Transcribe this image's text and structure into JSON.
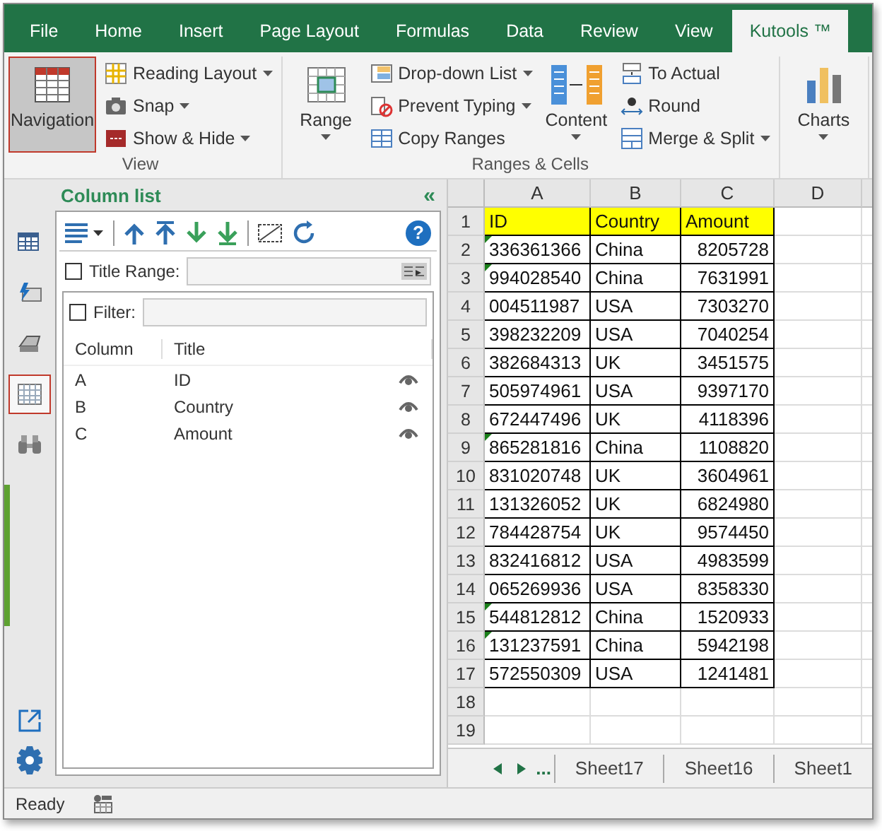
{
  "tabs": [
    {
      "label": "File",
      "selected": false
    },
    {
      "label": "Home",
      "selected": false
    },
    {
      "label": "Insert",
      "selected": false
    },
    {
      "label": "Page Layout",
      "selected": false
    },
    {
      "label": "Formulas",
      "selected": false
    },
    {
      "label": "Data",
      "selected": false
    },
    {
      "label": "Review",
      "selected": false
    },
    {
      "label": "View",
      "selected": false
    },
    {
      "label": "Kutools ™",
      "selected": true
    }
  ],
  "ribbon": {
    "groups": [
      {
        "label": "View",
        "items": [
          {
            "kind": "large",
            "label": "Navigation",
            "selected": true,
            "dropdown": false
          },
          {
            "kind": "small",
            "label": "Reading Layout",
            "dropdown": true
          },
          {
            "kind": "small",
            "label": "Snap",
            "dropdown": true
          },
          {
            "kind": "small",
            "label": "Show & Hide",
            "dropdown": true
          }
        ]
      },
      {
        "label": "Ranges & Cells",
        "items": [
          {
            "kind": "large",
            "label": "Range",
            "selected": false,
            "dropdown": true
          },
          {
            "kind": "small",
            "label": "Drop-down List",
            "dropdown": true
          },
          {
            "kind": "small",
            "label": "Prevent Typing",
            "dropdown": true
          },
          {
            "kind": "small",
            "label": "Copy Ranges",
            "dropdown": false
          },
          {
            "kind": "large",
            "label": "Content",
            "selected": false,
            "dropdown": true
          },
          {
            "kind": "small",
            "label": "To Actual",
            "dropdown": false
          },
          {
            "kind": "small",
            "label": "Round",
            "dropdown": false
          },
          {
            "kind": "small",
            "label": "Merge & Split",
            "dropdown": true
          }
        ]
      },
      {
        "items": [
          {
            "kind": "large",
            "label": "Charts",
            "selected": false,
            "dropdown": true
          }
        ]
      }
    ]
  },
  "nav_strip": [
    {
      "selected": false
    },
    {
      "selected": false
    },
    {
      "selected": false
    },
    {
      "selected": true
    },
    {
      "selected": false
    }
  ],
  "pane": {
    "title": "Column list",
    "collapse": "«",
    "help": "?",
    "title_range": {
      "label": "Title Range:",
      "checked": false
    },
    "filter": {
      "label": "Filter:",
      "checked": false
    },
    "columns": [
      "Column",
      "Title"
    ],
    "rows": [
      {
        "column": "A",
        "title": "ID",
        "visible": true
      },
      {
        "column": "B",
        "title": "Country",
        "visible": true
      },
      {
        "column": "C",
        "title": "Amount",
        "visible": true
      }
    ]
  },
  "sheet": {
    "columns": [
      "A",
      "B",
      "C",
      "D"
    ],
    "rows": [
      {
        "num": "1",
        "header": true,
        "cells": [
          "ID",
          "Country",
          "Amount"
        ]
      },
      {
        "num": "2",
        "flag": true,
        "cells": [
          "336361366",
          "China",
          "8205728"
        ]
      },
      {
        "num": "3",
        "flag": true,
        "cells": [
          "994028540",
          "China",
          "7631991"
        ]
      },
      {
        "num": "4",
        "cells": [
          "004511987",
          "USA",
          "7303270"
        ]
      },
      {
        "num": "5",
        "cells": [
          "398232209",
          "USA",
          "7040254"
        ]
      },
      {
        "num": "6",
        "cells": [
          "382684313",
          "UK",
          "3451575"
        ]
      },
      {
        "num": "7",
        "cells": [
          "505974961",
          "USA",
          "9397170"
        ]
      },
      {
        "num": "8",
        "cells": [
          "672447496",
          "UK",
          "4118396"
        ]
      },
      {
        "num": "9",
        "flag": true,
        "cells": [
          "865281816",
          "China",
          "1108820"
        ]
      },
      {
        "num": "10",
        "cells": [
          "831020748",
          "UK",
          "3604961"
        ]
      },
      {
        "num": "11",
        "cells": [
          "131326052",
          "UK",
          "6824980"
        ]
      },
      {
        "num": "12",
        "cells": [
          "784428754",
          "UK",
          "9574450"
        ]
      },
      {
        "num": "13",
        "cells": [
          "832416812",
          "USA",
          "4983599"
        ]
      },
      {
        "num": "14",
        "cells": [
          "065269936",
          "USA",
          "8358330"
        ]
      },
      {
        "num": "15",
        "flag": true,
        "cells": [
          "544812812",
          "China",
          "1520933"
        ]
      },
      {
        "num": "16",
        "flag": true,
        "cells": [
          "131237591",
          "China",
          "5942198"
        ]
      },
      {
        "num": "17",
        "cells": [
          "572550309",
          "USA",
          "1241481"
        ]
      },
      {
        "num": "18",
        "cells": []
      },
      {
        "num": "19",
        "cells": []
      }
    ],
    "more": "...",
    "sheet_tabs": [
      "Sheet17",
      "Sheet16",
      "Sheet1"
    ]
  },
  "status_bar": {
    "text": "Ready"
  }
}
